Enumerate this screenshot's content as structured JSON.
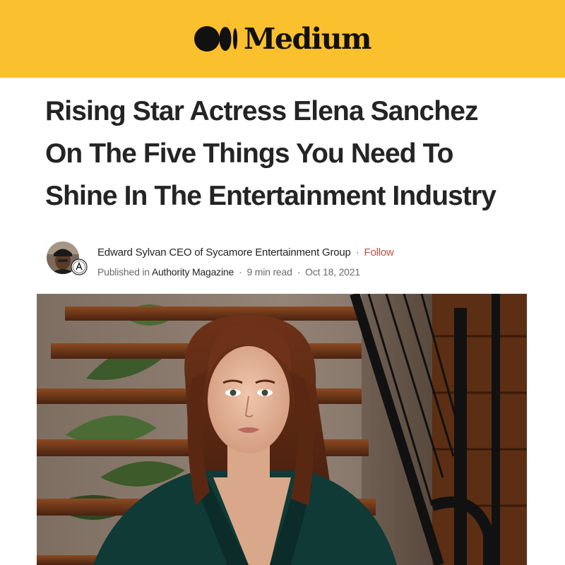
{
  "header": {
    "brand_name": "Medium",
    "background_color": "#fbc02d",
    "logo_icon": "medium-logo-icon"
  },
  "article": {
    "title_lines": [
      "Rising Star Actress Elena Sanchez",
      "On The Five Things You Need To",
      "Shine In The Entertainment Industry"
    ]
  },
  "byline": {
    "author": "Edward Sylvan CEO of Sycamore Entertainment Group",
    "separator": "·",
    "follow_label": "Follow",
    "follow_color": "#c94a3f",
    "published_prefix": "Published in",
    "publication": "Authority Magazine",
    "read_time": "9 min read",
    "date": "Oct 18, 2021",
    "avatar_icon": "author-avatar",
    "badge_icon": "publication-badge-icon"
  },
  "hero_image": {
    "subject": "portrait-photo"
  }
}
